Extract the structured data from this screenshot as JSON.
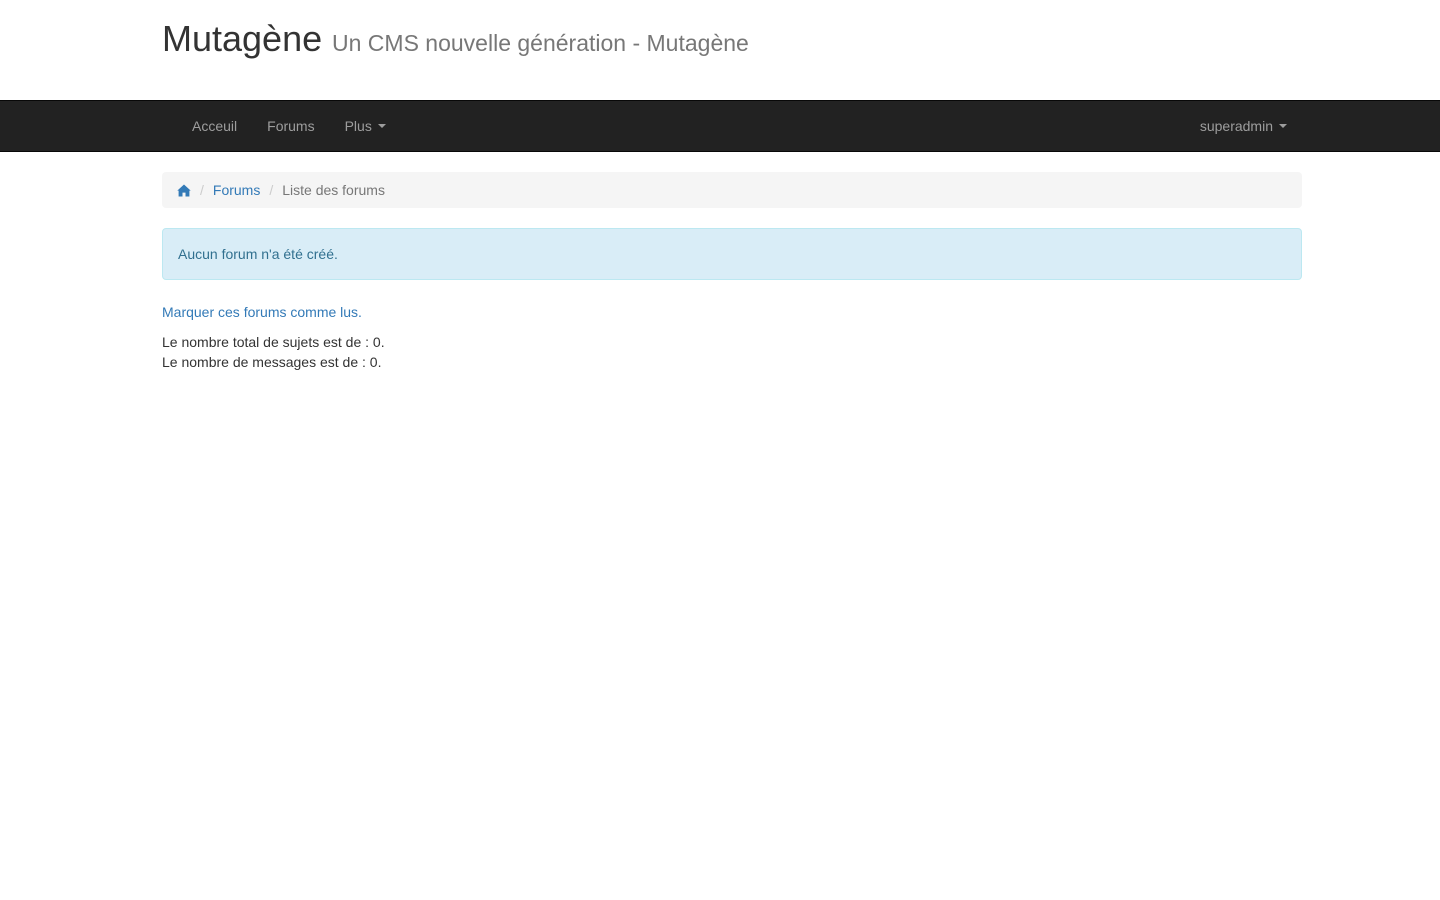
{
  "header": {
    "title": "Mutagène",
    "subtitle": "Un CMS nouvelle génération - Mutagène"
  },
  "navbar": {
    "items": [
      {
        "label": "Acceuil"
      },
      {
        "label": "Forums"
      },
      {
        "label": "Plus"
      }
    ],
    "user_label": "superadmin"
  },
  "breadcrumb": {
    "home_icon": "home-icon",
    "forums_label": "Forums",
    "current_label": "Liste des forums",
    "separator": "/"
  },
  "alert": {
    "message": "Aucun forum n'a été créé."
  },
  "mark_read_label": "Marquer ces forums comme lus.",
  "stats": {
    "topics_line": "Le nombre total de sujets est de : 0.",
    "messages_line": "Le nombre de messages est de : 0."
  },
  "colors": {
    "navbar_bg": "#222222",
    "link": "#337ab7",
    "alert_bg": "#d9edf7",
    "alert_text": "#31708f"
  }
}
